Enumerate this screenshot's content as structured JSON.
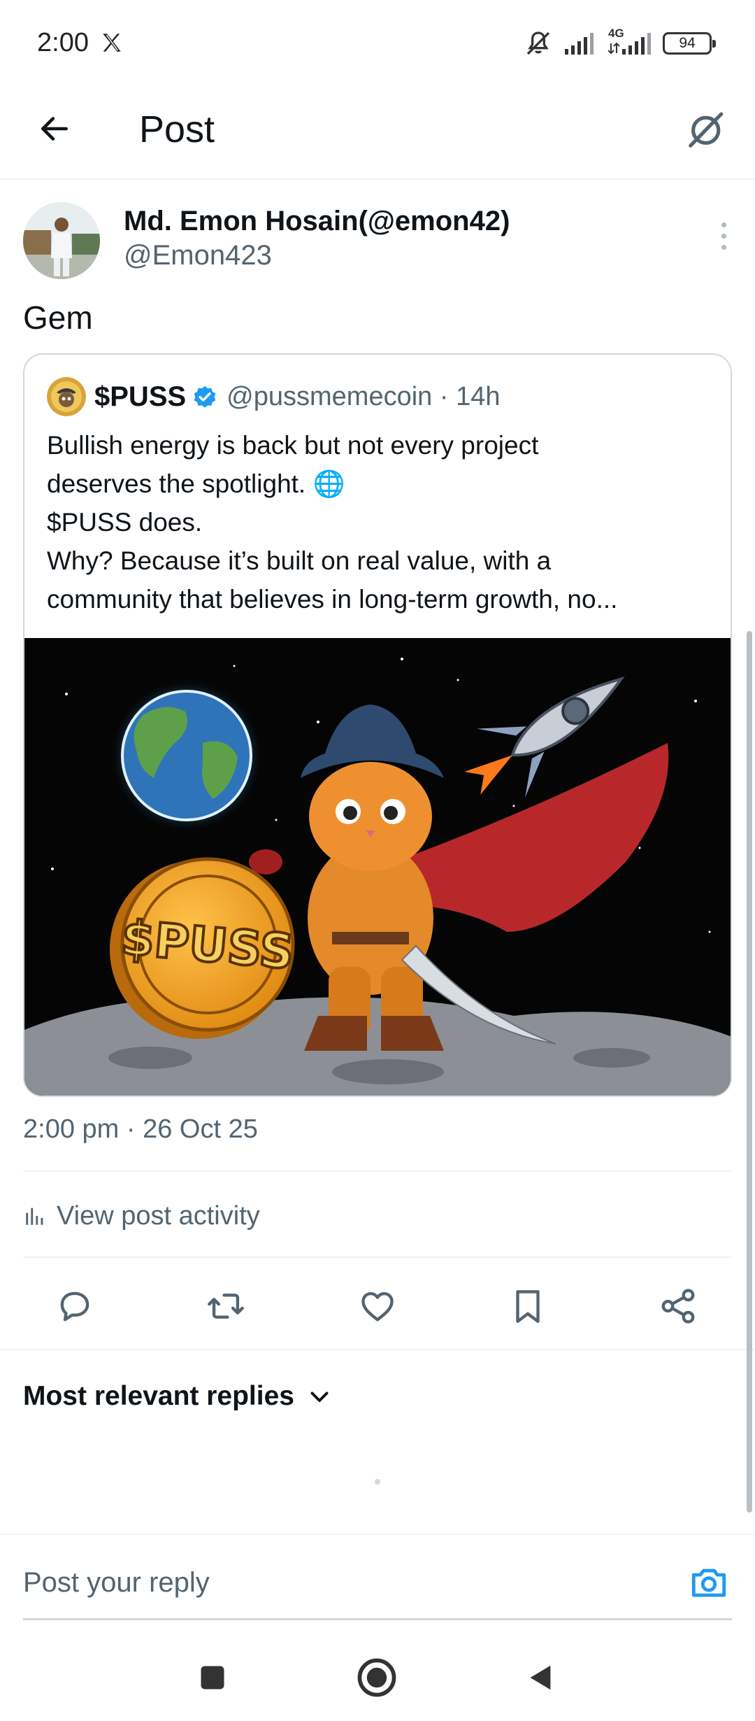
{
  "status_bar": {
    "time": "2:00",
    "network": "4G",
    "battery": "94"
  },
  "header": {
    "title": "Post"
  },
  "post": {
    "author_name": "Md. Emon Hosain(@emon42)",
    "author_handle": "@Emon423",
    "text": "Gem",
    "timestamp": "2:00 pm · 26 Oct 25",
    "activity_label": "View post activity"
  },
  "quoted_post": {
    "name": "$PUSS",
    "handle_time": "@pussmemecoin · 14h",
    "lines": [
      "Bullish energy is back  but not every project",
      "deserves the spotlight. 🌐",
      "$PUSS does.",
      "Why? Because it’s built on real value, with a",
      "community that believes in long-term growth, no..."
    ],
    "image_coin_text": "$PUSS"
  },
  "replies": {
    "sort_label": "Most relevant replies"
  },
  "composer": {
    "placeholder": "Post your reply"
  },
  "colors": {
    "accent": "#1d9bf0",
    "secondary_text": "#536471",
    "divider": "#eff3f4"
  },
  "icons": {
    "back": "arrow-left-icon",
    "grok": "grok-icon",
    "reply": "reply-icon",
    "repost": "repost-icon",
    "like": "heart-icon",
    "bookmark": "bookmark-icon",
    "share": "share-icon",
    "camera": "camera-icon"
  }
}
